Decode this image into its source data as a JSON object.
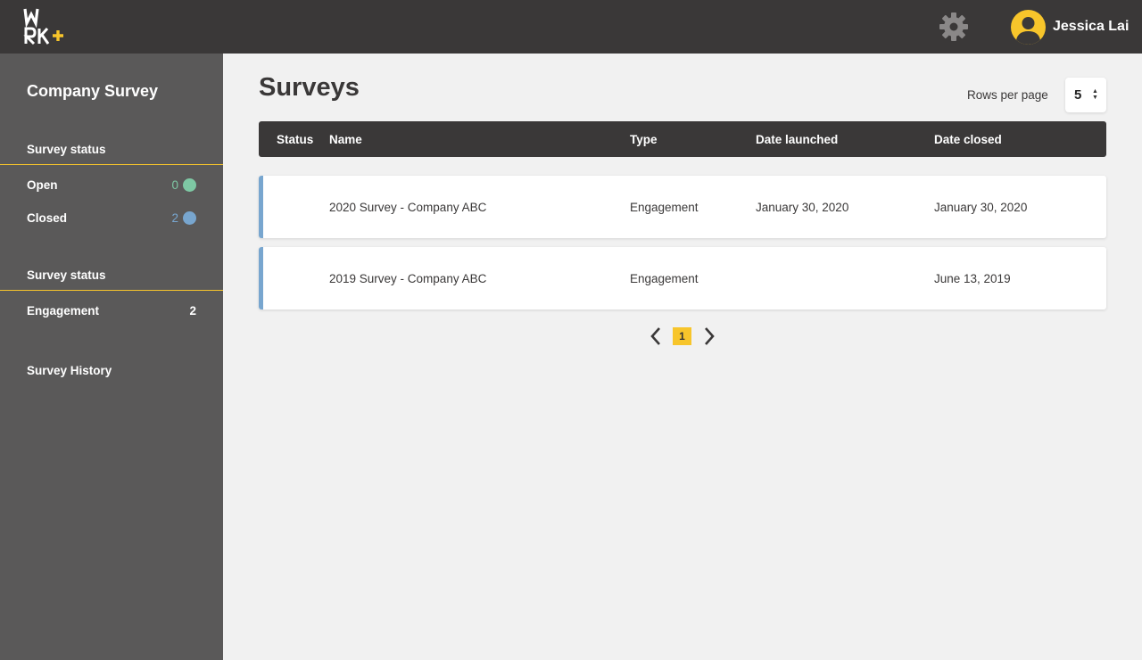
{
  "header": {
    "logo_text": "WRK+",
    "user_name": "Jessica Lai",
    "colors": {
      "bar": "#3a3838",
      "accent": "#f7c52b"
    }
  },
  "sidebar": {
    "title": "Company Survey",
    "status_section": {
      "label": "Survey status",
      "items": [
        {
          "label": "Open",
          "count": "0",
          "color": "#7ec8a4"
        },
        {
          "label": "Closed",
          "count": "2",
          "color": "#78a6cf"
        }
      ]
    },
    "type_section": {
      "label": "Survey status",
      "items": [
        {
          "label": "Engagement",
          "count": "2"
        }
      ]
    },
    "history_label": "Survey History"
  },
  "main": {
    "title": "Surveys",
    "rows_per_page": {
      "label": "Rows per page",
      "value": "5"
    },
    "table": {
      "columns": [
        "Status",
        "Name",
        "Type",
        "Date launched",
        "Date closed"
      ],
      "rows": [
        {
          "status": "closed",
          "name": "2020 Survey - Company ABC",
          "type": "Engagement",
          "date_launched": "January 30, 2020",
          "date_closed": "January 30, 2020"
        },
        {
          "status": "closed",
          "name": "2019 Survey - Company ABC",
          "type": "Engagement",
          "date_launched": "",
          "date_closed": "June 13, 2019"
        }
      ]
    },
    "pagination": {
      "current_page": "1"
    }
  }
}
